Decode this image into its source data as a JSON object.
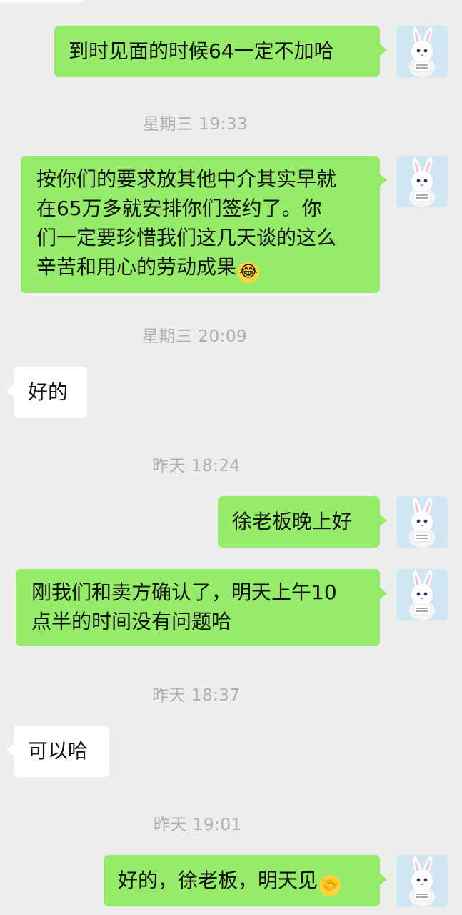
{
  "messages": [
    {
      "id": "m1",
      "dir": "out",
      "text": "到时见面的时候64一定不加哈"
    },
    {
      "id": "t1",
      "type": "time",
      "text": "星期三 19:33"
    },
    {
      "id": "m2",
      "dir": "out",
      "lines": [
        "按你们的要求放其他中介其实早就",
        "在65万多就安排你们签约了。你",
        "们一定要珍惜我们这几天谈的这么",
        "辛苦和用心的劳动成果"
      ],
      "emoji": "😂"
    },
    {
      "id": "t2",
      "type": "time",
      "text": "星期三 20:09"
    },
    {
      "id": "m3",
      "dir": "in",
      "text": "好的"
    },
    {
      "id": "t3",
      "type": "time",
      "text": "昨天 18:24"
    },
    {
      "id": "m4",
      "dir": "out",
      "text": "徐老板晚上好"
    },
    {
      "id": "m5",
      "dir": "out",
      "lines": [
        "刚我们和卖方确认了，明天上午10",
        "点半的时间没有问题哈"
      ]
    },
    {
      "id": "t4",
      "type": "time",
      "text": "昨天 18:37"
    },
    {
      "id": "m6",
      "dir": "in",
      "text": "可以哈"
    },
    {
      "id": "t5",
      "type": "time",
      "text": "昨天 19:01"
    },
    {
      "id": "m7",
      "dir": "out",
      "text": "好的，徐老板，明天见",
      "emoji": "🤝"
    }
  ],
  "avatar": {
    "icon": "bunny-avatar-icon",
    "sign_lines": [
      "CUTE IS",
      "JUST MY CODE"
    ]
  },
  "colors": {
    "background": "#ededed",
    "outgoing_bubble": "#95ec69",
    "incoming_bubble": "#ffffff",
    "timestamp": "#aeaeae",
    "avatar_bg": "#cfe6f5"
  }
}
